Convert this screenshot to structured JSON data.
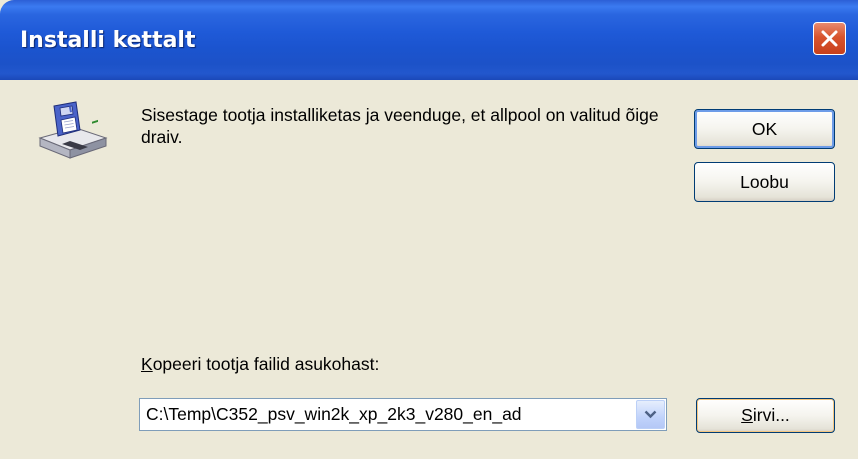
{
  "window": {
    "title": "Installi kettalt"
  },
  "message": {
    "text": "Sisestage tootja installiketas ja veenduge, et allpool on valitud õige draiv."
  },
  "buttons": {
    "ok_label": "OK",
    "cancel_label": "Loobu",
    "browse_mnemonic": "S",
    "browse_rest": "irvi..."
  },
  "copy_from": {
    "label_mnemonic": "K",
    "label_rest": "opeeri tootja failid asukohast:",
    "value": "C:\\Temp\\C352_psv_win2k_xp_2k3_v280_en_ad"
  },
  "icons": {
    "dialog": "floppy-disk-drive-icon",
    "close": "close-icon",
    "dropdown": "chevron-down-icon"
  },
  "colors": {
    "titlebar": "#1f5ad8",
    "dialog_background": "#ece9d8",
    "close_button": "#d8542e",
    "button_border": "#003c74"
  }
}
